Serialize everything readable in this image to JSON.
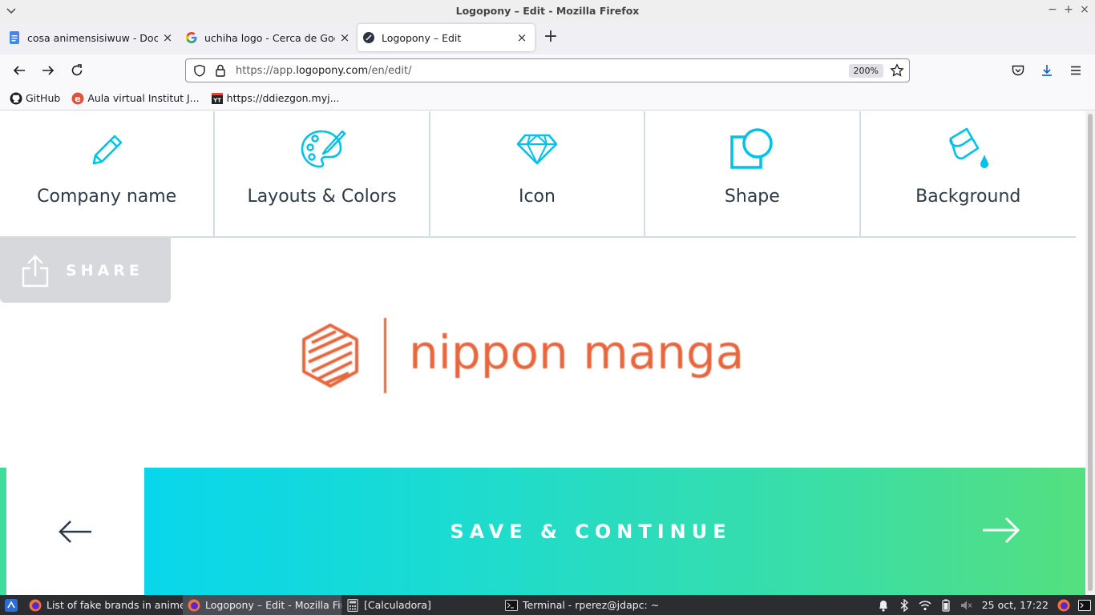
{
  "window": {
    "title": "Logopony – Edit - Mozilla Firefox"
  },
  "tabs": [
    {
      "label": "cosa animensisiwuw - Docum",
      "icon": "google-docs-icon",
      "active": false
    },
    {
      "label": "uchiha logo - Cerca de Google",
      "icon": "google-icon",
      "active": false
    },
    {
      "label": "Logopony – Edit",
      "icon": "logopony-icon",
      "active": true
    }
  ],
  "urlbar": {
    "prefix": "https://app.",
    "host": "logopony.com",
    "path": "/en/edit/",
    "zoom": "200%"
  },
  "bookmarks": [
    {
      "label": "GitHub",
      "icon": "github-icon"
    },
    {
      "label": "Aula virtual Institut J...",
      "icon": "moodle-icon"
    },
    {
      "label": "https://ddiezgon.myj...",
      "icon": "yt-icon"
    }
  ],
  "tools": [
    {
      "label": "Company name",
      "icon": "pencil-icon"
    },
    {
      "label": "Layouts & Colors",
      "icon": "palette-icon"
    },
    {
      "label": "Icon",
      "icon": "diamond-icon"
    },
    {
      "label": "Shape",
      "icon": "shape-icon"
    },
    {
      "label": "Background",
      "icon": "paint-bucket-icon"
    }
  ],
  "share": {
    "label": "SHARE"
  },
  "logo": {
    "text": "nippon manga",
    "color": "#e8663d"
  },
  "footer": {
    "save_label": "SAVE & CONTINUE"
  },
  "colors": {
    "accent": "#00d4f7",
    "toolText": "#2d3b48",
    "gradientEnd": "#55df7f"
  },
  "taskbar": {
    "items": [
      {
        "label": "List of fake brands in anime ...",
        "icon": "firefox-icon",
        "active": false
      },
      {
        "label": "Logopony – Edit - Mozilla Fir...",
        "icon": "firefox-icon",
        "active": true
      },
      {
        "label": "[Calculadora]",
        "icon": "calculator-icon",
        "active": false
      },
      {
        "label": "Terminal - rperez@jdapc: ~/...",
        "icon": "terminal-icon",
        "active": false
      }
    ],
    "clock": "25 oct, 17:22"
  }
}
